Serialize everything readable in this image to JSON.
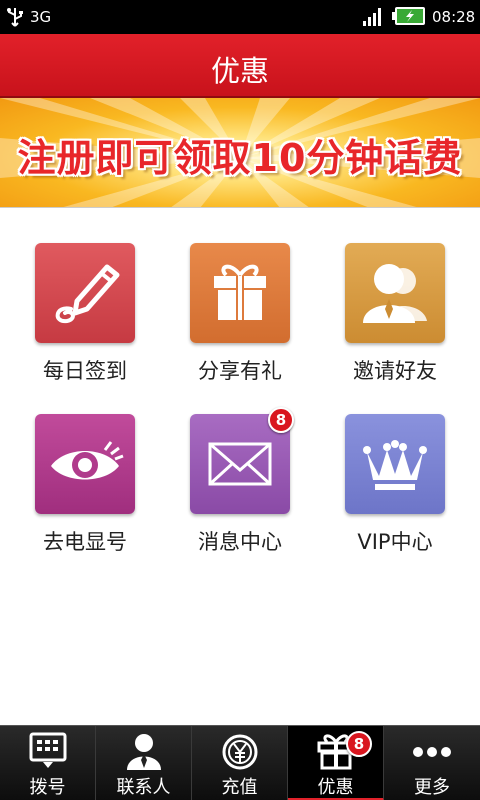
{
  "status_bar": {
    "network": "3G",
    "time": "08:28",
    "icons": [
      "usb-icon",
      "signal-icon",
      "battery-charging-icon"
    ]
  },
  "header": {
    "title": "优惠"
  },
  "banner": {
    "text": "注册即可领取10分钟话费"
  },
  "grid": [
    {
      "label": "每日签到",
      "icon": "pen-icon",
      "color": "#d2454c"
    },
    {
      "label": "分享有礼",
      "icon": "gift-icon",
      "color": "#dd7a3c"
    },
    {
      "label": "邀请好友",
      "icon": "users-icon",
      "color": "#d59a3e"
    },
    {
      "label": "去电显号",
      "icon": "eye-icon",
      "color": "#b03b8c"
    },
    {
      "label": "消息中心",
      "icon": "envelope-icon",
      "color": "#9a5ab4",
      "badge": "8"
    },
    {
      "label": "VIP中心",
      "icon": "crown-icon",
      "color": "#7b84d4"
    }
  ],
  "bottom_nav": [
    {
      "label": "拨号",
      "icon": "dialpad-icon"
    },
    {
      "label": "联系人",
      "icon": "contact-icon"
    },
    {
      "label": "充值",
      "icon": "yuan-coin-icon"
    },
    {
      "label": "优惠",
      "icon": "gift-icon",
      "badge": "8",
      "active": true
    },
    {
      "label": "更多",
      "icon": "more-dots-icon"
    }
  ],
  "colors": {
    "header_red": "#d8161f",
    "badge_red": "#d9161f"
  }
}
